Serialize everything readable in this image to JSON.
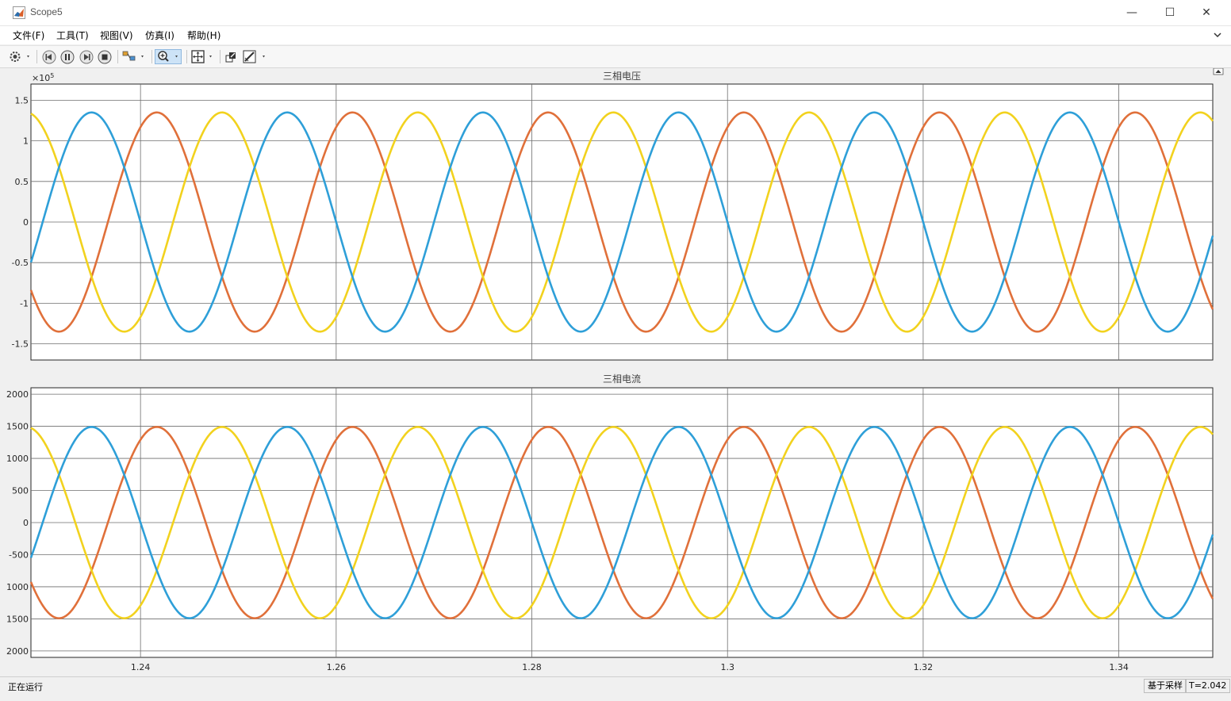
{
  "window": {
    "title": "Scope5",
    "controls": {
      "minimize": "—",
      "maximize": "☐",
      "close": "✕"
    }
  },
  "menu": [
    {
      "label": "文件(F)"
    },
    {
      "label": "工具(T)"
    },
    {
      "label": "视图(V)"
    },
    {
      "label": "仿真(I)"
    },
    {
      "label": "帮助(H)"
    }
  ],
  "toolbar": {
    "icons": [
      "gear-icon",
      "step-back-icon",
      "pause-icon",
      "step-forward-icon",
      "stop-icon",
      "signal-select-icon",
      "zoom-in-icon",
      "fit-to-view-icon",
      "restore-icon",
      "style-brush-icon"
    ]
  },
  "colors": {
    "series_orange": "#E0703A",
    "series_yellow": "#F2D21E",
    "series_blue": "#2E9FD8",
    "grid": "#6e6e6e"
  },
  "status": {
    "left": "正在运行",
    "mode": "基于采样",
    "time": "T=2.042"
  },
  "chart_data": [
    {
      "type": "line",
      "title": "三相电压",
      "xlabel": "",
      "ylabel": "",
      "y_exponent_label": "×10",
      "y_exponent_power": "5",
      "xlim": [
        1.2288,
        1.3496
      ],
      "ylim": [
        -1.7,
        1.7
      ],
      "xticks": [
        1.24,
        1.26,
        1.28,
        1.3,
        1.32,
        1.34
      ],
      "xtick_labels": [
        "1.24",
        "1.26",
        "1.28",
        "1.3",
        "1.32",
        "1.34"
      ],
      "yticks": [
        1.5,
        1,
        0.5,
        0,
        -0.5,
        -1,
        -1.5
      ],
      "ytick_labels": [
        "1.5",
        "1",
        "0.5",
        "0",
        "-0.5",
        "-1",
        "-1.5"
      ],
      "grid": true,
      "series": [
        {
          "color": "#E0703A",
          "amplitude": 1.35,
          "frequency_hz": 50,
          "phase_deg": 60
        },
        {
          "color": "#F2D21E",
          "amplitude": 1.35,
          "frequency_hz": 50,
          "phase_deg": -60
        },
        {
          "color": "#2E9FD8",
          "amplitude": 1.35,
          "frequency_hz": 50,
          "phase_deg": 180
        }
      ]
    },
    {
      "type": "line",
      "title": "三相电流",
      "xlabel": "",
      "ylabel": "",
      "xlim": [
        1.2288,
        1.3496
      ],
      "ylim": [
        -2100,
        2100
      ],
      "xticks": [
        1.24,
        1.26,
        1.28,
        1.3,
        1.32,
        1.34
      ],
      "xtick_labels": [
        "1.24",
        "1.26",
        "1.28",
        "1.3",
        "1.32",
        "1.34"
      ],
      "yticks": [
        2000,
        1500,
        1000,
        500,
        0,
        -500,
        -1000,
        -1500,
        -2000
      ],
      "ytick_labels": [
        "2000",
        "1500",
        "1000",
        "500",
        "0",
        "-500",
        "-1000",
        "-1500",
        "-2000"
      ],
      "grid": true,
      "series": [
        {
          "color": "#E0703A",
          "amplitude": 1490,
          "frequency_hz": 50,
          "phase_deg": 60
        },
        {
          "color": "#F2D21E",
          "amplitude": 1490,
          "frequency_hz": 50,
          "phase_deg": -60
        },
        {
          "color": "#2E9FD8",
          "amplitude": 1490,
          "frequency_hz": 50,
          "phase_deg": 180
        }
      ]
    }
  ]
}
